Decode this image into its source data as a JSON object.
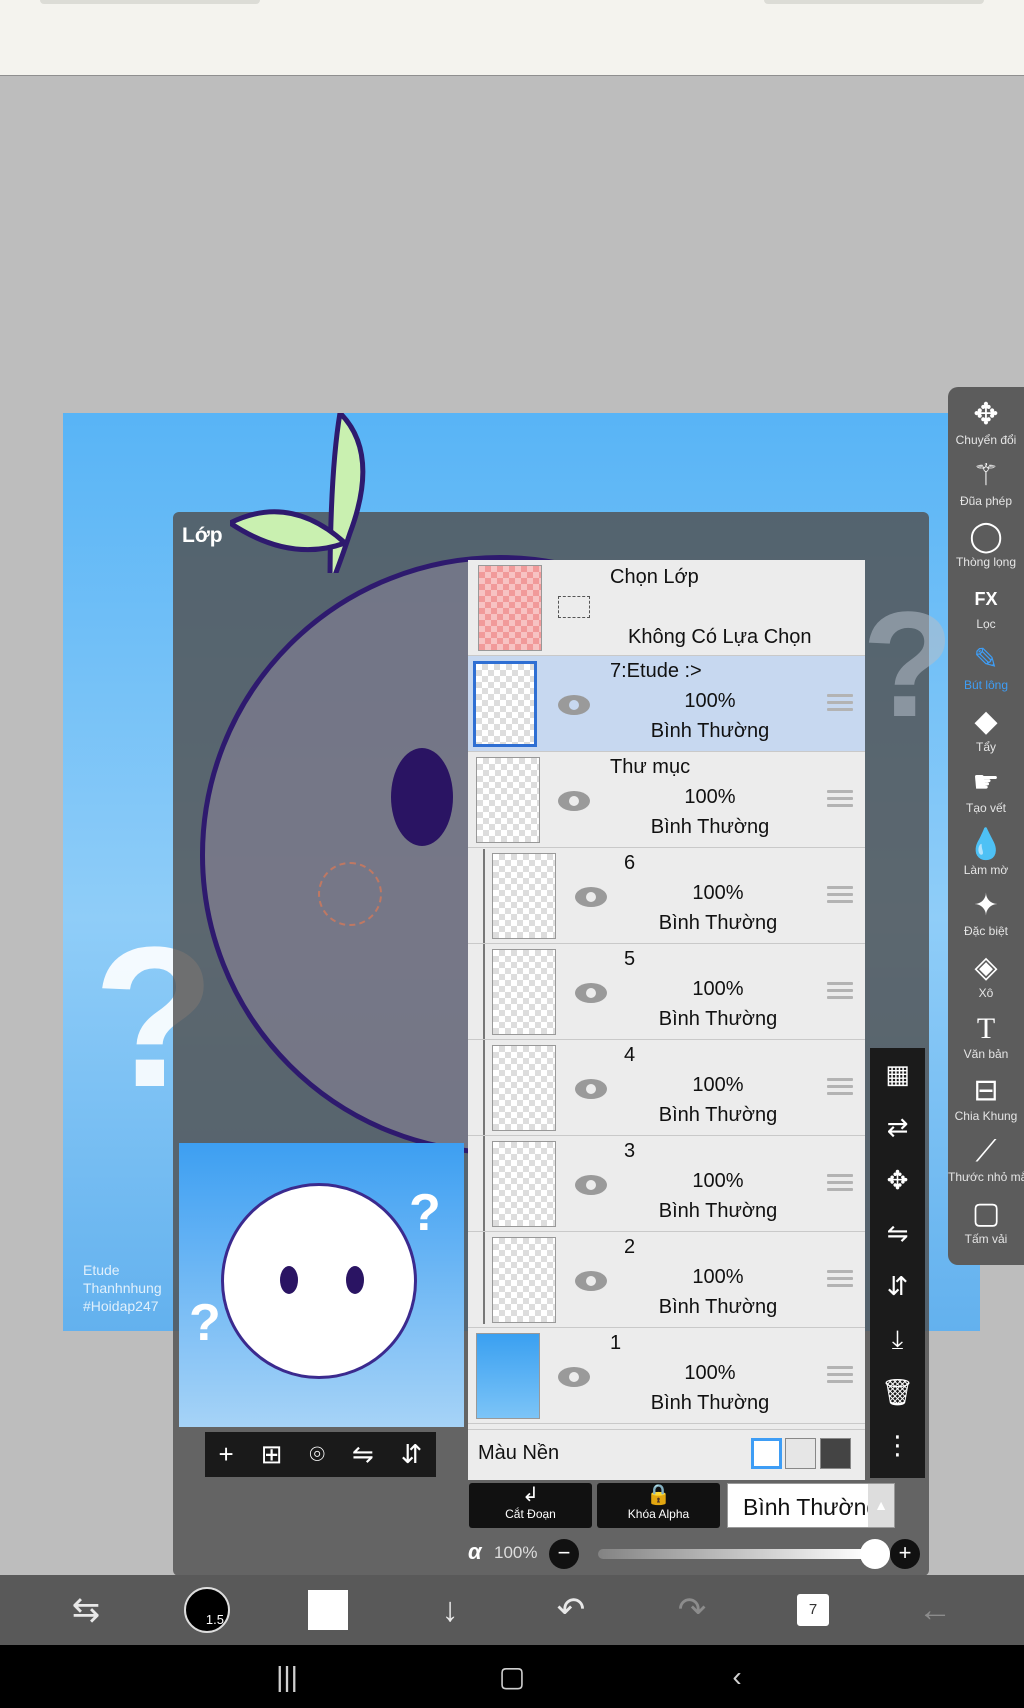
{
  "panel_title": "Lớp",
  "selection_row": {
    "title": "Chọn Lớp",
    "status": "Không Có Lựa Chọn"
  },
  "layers": [
    {
      "name": "7:Etude :>",
      "opacity": "100%",
      "mode": "Bình Thường",
      "selected": true
    },
    {
      "name": "Thư mục",
      "opacity": "100%",
      "mode": "Bình Thường",
      "folder": true
    },
    {
      "name": "6",
      "opacity": "100%",
      "mode": "Bình Thường"
    },
    {
      "name": "5",
      "opacity": "100%",
      "mode": "Bình Thường"
    },
    {
      "name": "4",
      "opacity": "100%",
      "mode": "Bình Thường"
    },
    {
      "name": "3",
      "opacity": "100%",
      "mode": "Bình Thường"
    },
    {
      "name": "2",
      "opacity": "100%",
      "mode": "Bình Thường"
    },
    {
      "name": "1",
      "opacity": "100%",
      "mode": "Bình Thường"
    }
  ],
  "background_color_label": "Màu Nền",
  "actions": {
    "clip": "Cắt Đoạn",
    "alpha_lock": "Khóa Alpha",
    "blend_mode": "Bình Thường"
  },
  "alpha": {
    "symbol": "α",
    "value": "100%"
  },
  "canvas_signature": [
    "Etude",
    "Thanhnhung",
    "#Hoidap247"
  ],
  "right_tools": [
    {
      "label": "Chuyển đổi",
      "icon": "move-icon"
    },
    {
      "label": "Đũa phép",
      "icon": "magic-wand-icon"
    },
    {
      "label": "Thòng lọng",
      "icon": "lasso-icon"
    },
    {
      "label": "Lọc",
      "icon": "fx-filter-icon"
    },
    {
      "label": "Bút lông",
      "icon": "brush-icon",
      "active": true
    },
    {
      "label": "Tẩy",
      "icon": "eraser-icon"
    },
    {
      "label": "Tạo vết",
      "icon": "smudge-icon"
    },
    {
      "label": "Làm mờ",
      "icon": "blur-icon"
    },
    {
      "label": "Đặc biệt",
      "icon": "special-brush-icon"
    },
    {
      "label": "Xô",
      "icon": "bucket-icon"
    },
    {
      "label": "Văn bản",
      "icon": "text-icon"
    },
    {
      "label": "Chia Khung",
      "icon": "frame-divider-icon"
    },
    {
      "label": "Thước nhỏ mắt",
      "icon": "eyedropper-icon"
    },
    {
      "label": "Tấm vải",
      "icon": "canvas-icon"
    }
  ],
  "bottom_bar": {
    "brush_size": "1.5",
    "pages": "7"
  },
  "colors": {
    "accent": "#3e9df5",
    "selected_row": "#c7d8f0",
    "canvas_blue": "#58b4f6",
    "ink": "#2e1a6e"
  }
}
